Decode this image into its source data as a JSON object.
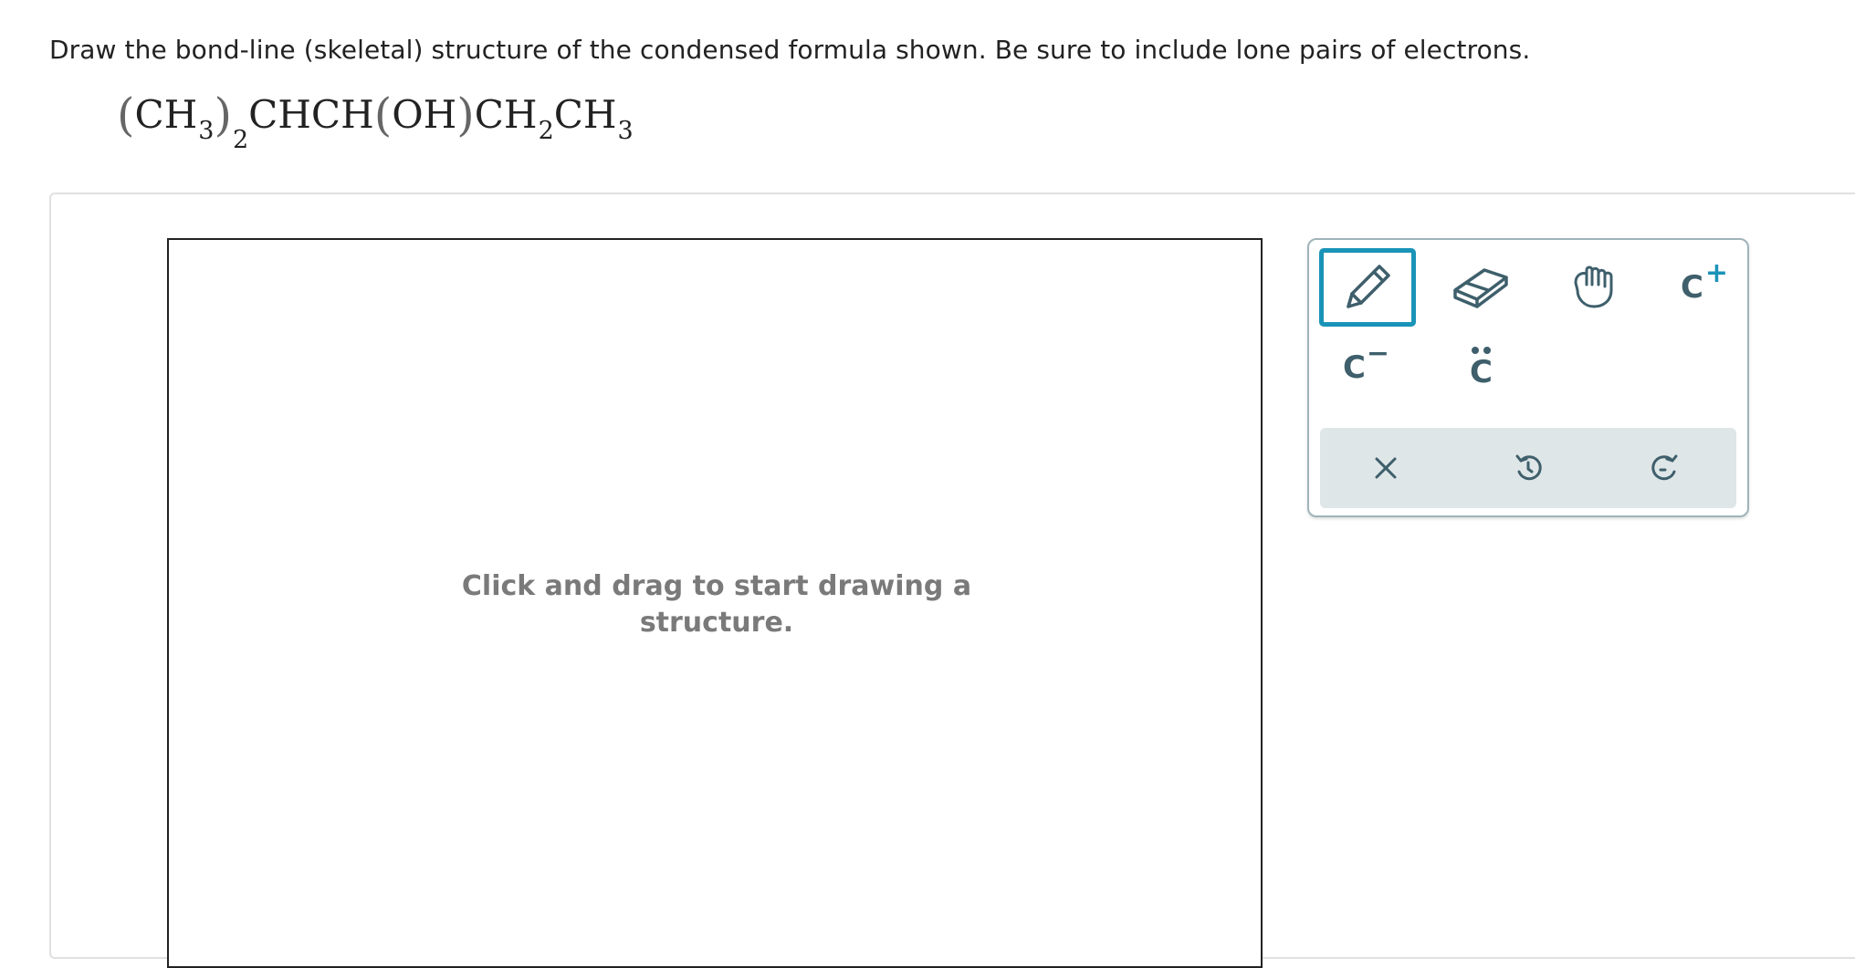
{
  "question": {
    "text": "Draw the bond-line (skeletal) structure of the condensed formula shown. Be sure to include lone pairs of electrons."
  },
  "formula": {
    "paren_open": "(",
    "part1": "CH",
    "sub1": "3",
    "paren_close": ")",
    "sub2": "2",
    "part2": "CHCH",
    "paren_open2": "(",
    "part3": "OH",
    "paren_close2": ")",
    "part4": "CH",
    "sub3": "2",
    "part5": "CH",
    "sub4": "3"
  },
  "canvas": {
    "hint_line1": "Click and drag to start drawing a",
    "hint_line2": "structure."
  },
  "toolbar": {
    "tools": [
      {
        "name": "pencil-icon",
        "selected": true
      },
      {
        "name": "eraser-icon",
        "selected": false
      },
      {
        "name": "hand-icon",
        "selected": false
      },
      {
        "name": "carbocation",
        "label": "C",
        "charge": "+"
      },
      {
        "name": "carbanion",
        "label": "C",
        "charge": "−"
      },
      {
        "name": "lone-pair",
        "label": "C"
      }
    ],
    "actions": [
      "clear-icon",
      "undo-icon",
      "redo-icon"
    ]
  },
  "colors": {
    "accent": "#1a93b8",
    "icon": "#3e5f6b",
    "plus": "#1a93b8",
    "action_bar_bg": "#dfe6e8",
    "hint_text": "#7a7a7a"
  }
}
